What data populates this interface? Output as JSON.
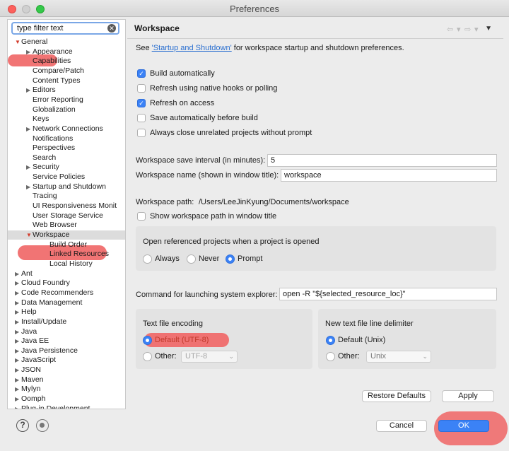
{
  "window": {
    "title": "Preferences"
  },
  "filter": {
    "text": "type filter text"
  },
  "tree": [
    {
      "label": "General",
      "level": 0,
      "twisty": "open"
    },
    {
      "label": "Appearance",
      "level": 1,
      "twisty": "closed"
    },
    {
      "label": "Capabilities",
      "level": 1,
      "twisty": ""
    },
    {
      "label": "Compare/Patch",
      "level": 1,
      "twisty": ""
    },
    {
      "label": "Content Types",
      "level": 1,
      "twisty": ""
    },
    {
      "label": "Editors",
      "level": 1,
      "twisty": "closed"
    },
    {
      "label": "Error Reporting",
      "level": 1,
      "twisty": ""
    },
    {
      "label": "Globalization",
      "level": 1,
      "twisty": ""
    },
    {
      "label": "Keys",
      "level": 1,
      "twisty": ""
    },
    {
      "label": "Network Connections",
      "level": 1,
      "twisty": "closed"
    },
    {
      "label": "Notifications",
      "level": 1,
      "twisty": ""
    },
    {
      "label": "Perspectives",
      "level": 1,
      "twisty": ""
    },
    {
      "label": "Search",
      "level": 1,
      "twisty": ""
    },
    {
      "label": "Security",
      "level": 1,
      "twisty": "closed"
    },
    {
      "label": "Service Policies",
      "level": 1,
      "twisty": ""
    },
    {
      "label": "Startup and Shutdown",
      "level": 1,
      "twisty": "closed"
    },
    {
      "label": "Tracing",
      "level": 1,
      "twisty": ""
    },
    {
      "label": "UI Responsiveness Monit",
      "level": 1,
      "twisty": ""
    },
    {
      "label": "User Storage Service",
      "level": 1,
      "twisty": ""
    },
    {
      "label": "Web Browser",
      "level": 1,
      "twisty": ""
    },
    {
      "label": "Workspace",
      "level": 1,
      "twisty": "open",
      "selected": true
    },
    {
      "label": "Build Order",
      "level": 2,
      "twisty": ""
    },
    {
      "label": "Linked Resources",
      "level": 2,
      "twisty": ""
    },
    {
      "label": "Local History",
      "level": 2,
      "twisty": ""
    },
    {
      "label": "Ant",
      "level": 0,
      "twisty": "closed"
    },
    {
      "label": "Cloud Foundry",
      "level": 0,
      "twisty": "closed"
    },
    {
      "label": "Code Recommenders",
      "level": 0,
      "twisty": "closed"
    },
    {
      "label": "Data Management",
      "level": 0,
      "twisty": "closed"
    },
    {
      "label": "Help",
      "level": 0,
      "twisty": "closed"
    },
    {
      "label": "Install/Update",
      "level": 0,
      "twisty": "closed"
    },
    {
      "label": "Java",
      "level": 0,
      "twisty": "closed"
    },
    {
      "label": "Java EE",
      "level": 0,
      "twisty": "closed"
    },
    {
      "label": "Java Persistence",
      "level": 0,
      "twisty": "closed"
    },
    {
      "label": "JavaScript",
      "level": 0,
      "twisty": "closed"
    },
    {
      "label": "JSON",
      "level": 0,
      "twisty": "closed"
    },
    {
      "label": "Maven",
      "level": 0,
      "twisty": "closed"
    },
    {
      "label": "Mylyn",
      "level": 0,
      "twisty": "closed"
    },
    {
      "label": "Oomph",
      "level": 0,
      "twisty": "closed"
    },
    {
      "label": "Plug-in Development",
      "level": 0,
      "twisty": "closed"
    }
  ],
  "page": {
    "title": "Workspace",
    "see_prefix": "See ",
    "see_link": "'Startup and Shutdown'",
    "see_suffix": " for workspace startup and shutdown preferences."
  },
  "checkboxes": [
    {
      "label": "Build automatically",
      "checked": true
    },
    {
      "label": "Refresh using native hooks or polling",
      "checked": false
    },
    {
      "label": "Refresh on access",
      "checked": true
    },
    {
      "label": "Save automatically before build",
      "checked": false
    },
    {
      "label": "Always close unrelated projects without prompt",
      "checked": false
    }
  ],
  "fields": {
    "save_interval_label": "Workspace save interval (in minutes):",
    "save_interval_value": "5",
    "name_label": "Workspace name (shown in window title):",
    "name_value": "workspace",
    "path_label": "Workspace path:",
    "path_value": "/Users/LeeJinKyung/Documents/workspace",
    "show_path_label": "Show workspace path in window title",
    "show_path_checked": false,
    "explorer_label": "Command for launching system explorer:",
    "explorer_value": "open -R \"${selected_resource_loc}\""
  },
  "open_projects": {
    "label": "Open referenced projects when a project is opened",
    "options": [
      "Always",
      "Never",
      "Prompt"
    ],
    "selected": "Prompt"
  },
  "encoding": {
    "label": "Text file encoding",
    "default_label": "Default (UTF-8)",
    "other_label": "Other:",
    "other_value": "UTF-8",
    "selected": "default"
  },
  "delimiter": {
    "label": "New text file line delimiter",
    "default_label": "Default (Unix)",
    "other_label": "Other:",
    "other_value": "Unix",
    "selected": "default"
  },
  "buttons": {
    "restore_defaults": "Restore Defaults",
    "apply": "Apply",
    "cancel": "Cancel",
    "ok": "OK"
  },
  "icons": {
    "help": "?",
    "check": "✓",
    "clear": "✕",
    "triangle_open": "▼",
    "triangle_closed": "▶",
    "nav_back": "⇦",
    "nav_forward": "⇨",
    "nav_dropdown": "▾",
    "menu": "▼",
    "combo_arrow": "⌄"
  },
  "colors": {
    "accent": "#3b82f6",
    "highlight": "#f06565",
    "link": "#2a6fd0"
  }
}
